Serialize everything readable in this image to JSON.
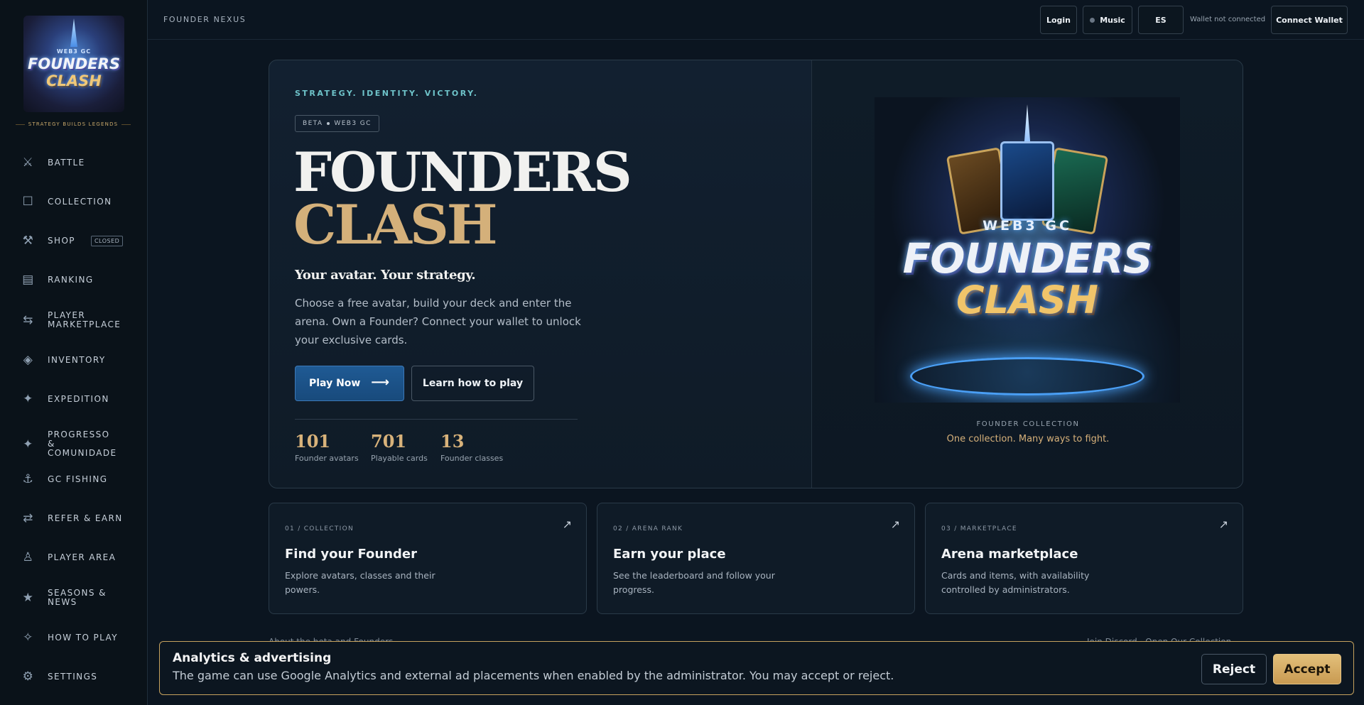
{
  "sidebar": {
    "logo": {
      "top": "WEB3 GC",
      "line1": "FOUNDERS",
      "line2": "CLASH"
    },
    "tagline": "STRATEGY BUILDS LEGENDS",
    "items": [
      {
        "label": "BATTLE",
        "icon": "swords-icon"
      },
      {
        "label": "COLLECTION",
        "icon": "square-icon"
      },
      {
        "label": "SHOP",
        "icon": "hammer-pick-icon",
        "badge": "CLOSED"
      },
      {
        "label": "RANKING",
        "icon": "list-icon"
      },
      {
        "label": "PLAYER MARKETPLACE",
        "icon": "swap-icon"
      },
      {
        "label": "INVENTORY",
        "icon": "diamond-icon"
      },
      {
        "label": "EXPEDITION",
        "icon": "sparkle-icon"
      },
      {
        "label": "PROGRESSO & COMUNIDADE",
        "icon": "star-sparkle-icon"
      },
      {
        "label": "GC FISHING",
        "icon": "anchor-icon"
      },
      {
        "label": "REFER & EARN",
        "icon": "exchange-arrows-icon"
      },
      {
        "label": "PLAYER AREA",
        "icon": "person-icon"
      },
      {
        "label": "SEASONS & NEWS",
        "icon": "star-icon"
      },
      {
        "label": "HOW TO PLAY",
        "icon": "outline-sparkle-icon"
      },
      {
        "label": "SETTINGS",
        "icon": "gear-icon"
      }
    ]
  },
  "topbar": {
    "brand": "FOUNDER NEXUS",
    "login": "Login",
    "music": "Music",
    "language": "ES",
    "wallet_status": "Wallet not connected",
    "connect_wallet": "Connect Wallet"
  },
  "hero": {
    "kicker": "STRATEGY. IDENTITY. VICTORY.",
    "pill_left": "BETA",
    "pill_right": "WEB3 GC",
    "title_line1": "FOUNDERS",
    "title_line2": "CLASH",
    "subhead": "Your avatar. Your strategy.",
    "description": "Choose a free avatar, build your deck and enter the arena. Own a Founder? Connect your wallet to unlock your exclusive cards.",
    "play_label": "Play Now",
    "learn_label": "Learn how to play",
    "stats": [
      {
        "value": "101",
        "label": "Founder avatars"
      },
      {
        "value": "701",
        "label": "Playable cards"
      },
      {
        "value": "13",
        "label": "Founder classes"
      }
    ],
    "art": {
      "web3": "WEB3 GC",
      "line1": "FOUNDERS",
      "line2": "CLASH"
    },
    "caption_kicker": "FOUNDER COLLECTION",
    "caption": "One collection. Many ways to fight."
  },
  "features": [
    {
      "tag": "01 / COLLECTION",
      "title": "Find your Founder",
      "description": "Explore avatars, classes and their powers."
    },
    {
      "tag": "02 / ARENA RANK",
      "title": "Earn your place",
      "description": "See the leaderboard and follow your progress."
    },
    {
      "tag": "03 / MARKETPLACE",
      "title": "Arena marketplace",
      "description": "Cards and items, with availability controlled by administrators."
    }
  ],
  "footer": {
    "left_link": "About the beta and Founders",
    "right_link": "Join Discord · Open Our Collection"
  },
  "consent": {
    "title": "Analytics & advertising",
    "text": "The game can use Google Analytics and external ad placements when enabled by the administrator. You may accept or reject.",
    "reject": "Reject",
    "accept": "Accept"
  },
  "colors": {
    "accent_gold": "#d4b07a",
    "accent_teal": "#6ec3c9",
    "primary_blue": "#1f5a94",
    "background": "#0b1520"
  }
}
